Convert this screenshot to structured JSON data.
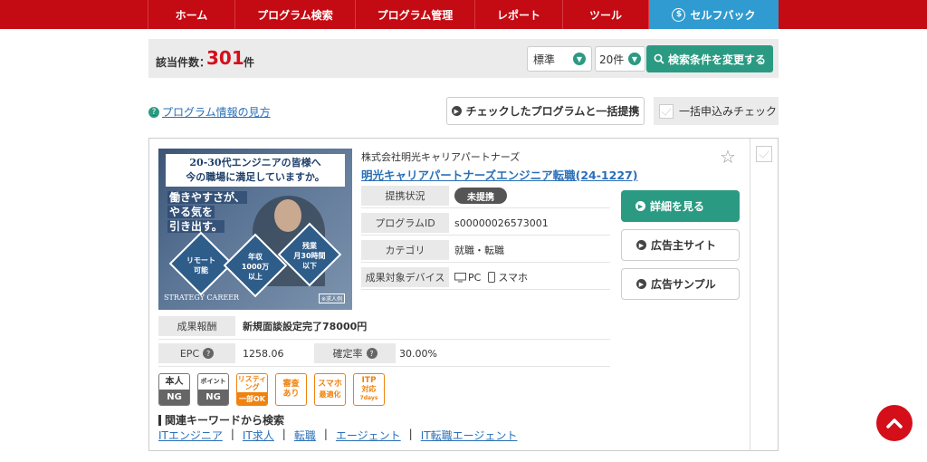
{
  "nav": {
    "items": [
      {
        "label": "ホーム"
      },
      {
        "label": "プログラム検索"
      },
      {
        "label": "プログラム管理"
      },
      {
        "label": "レポート"
      },
      {
        "label": "ツール"
      },
      {
        "label": "セルフバック",
        "icon": "self-back-icon"
      }
    ],
    "colors": {
      "bar": "#c40a13",
      "active": "#2f9bd1"
    }
  },
  "results": {
    "count_label": "該当件数：",
    "count": "301",
    "count_unit": "件",
    "sort_selected": "標準",
    "per_page_selected": "20件",
    "change_button": "検索条件を変更する"
  },
  "toolbar": {
    "help_link": "プログラム情報の見方",
    "bulk_partner_button": "チェックしたプログラムと一括提携",
    "bulk_apply_check": "一括申込みチェック"
  },
  "program": {
    "company": "株式会社明光キャリアパートナーズ",
    "title": "明光キャリアパートナーズエンジニア転職(24-1227)",
    "banner": {
      "headline_1": "20-30代エンジニアの皆様へ",
      "headline_2": "今の職場に満足していますか。",
      "sub_1": "働きやすさが、",
      "sub_2": "やる気を",
      "sub_3": "引き出す。",
      "badge_1_a": "リモート",
      "badge_1_b": "可能",
      "badge_2_a": "年収",
      "badge_2_b": "1000万",
      "badge_2_c": "以上",
      "badge_3_a": "残業",
      "badge_3_b": "月30時間",
      "badge_3_c": "以下",
      "brand": "STRATEGY CAREER",
      "note": "※求人例"
    },
    "info": [
      {
        "key": "提携状況",
        "value": "未提携"
      },
      {
        "key": "プログラムID",
        "value": "s00000026573001"
      },
      {
        "key": "カテゴリ",
        "value": "就職・転職"
      },
      {
        "key": "成果対象デバイス",
        "pc": "PC",
        "sp": "スマホ"
      }
    ],
    "actions": {
      "detail": "詳細を見る",
      "advertiser_site": "広告主サイト",
      "ad_sample": "広告サンプル"
    },
    "reward_key": "成果報酬",
    "reward_value": "新規面談設定完了78000円",
    "epc_key": "EPC",
    "epc_value": "1258.06",
    "rate_key": "確定率",
    "rate_value": "30.00%",
    "tags": {
      "self_top": "本人",
      "self_bot": "NG",
      "point_top": "ポイント",
      "point_bot": "NG",
      "listing_top_1": "リスティ",
      "listing_top_2": "ング",
      "listing_bot": "一部OK",
      "review_1": "審査",
      "review_2": "あり",
      "mobile_1": "スマホ",
      "mobile_2": "最適化",
      "itp_1": "ITP",
      "itp_2": "対応",
      "itp_3": "7days"
    },
    "keywords_title": "関連キーワードから検索",
    "keywords": [
      "ITエンジニア",
      "IT求人",
      "転職",
      "エージェント",
      "IT転職エージェント"
    ]
  }
}
